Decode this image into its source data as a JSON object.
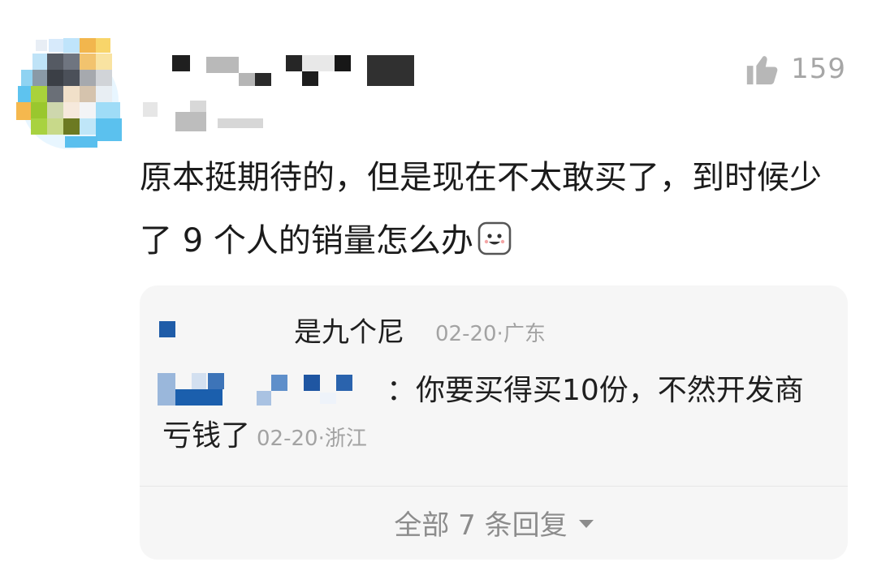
{
  "comment": {
    "like_count": "159",
    "text": "原本挺期待的，但是现在不太敢买了，到时候少了 9 个人的销量怎么办",
    "emoji_icon": "smiling-face-emoji-icon"
  },
  "replies": {
    "reply_1": {
      "text": "是九个尼",
      "meta": "02-20·广东"
    },
    "reply_2": {
      "text": "：你要买得买10份，不然开发商亏钱了",
      "meta": "02-20·浙江"
    },
    "view_all_label": "全部 7 条回复"
  }
}
